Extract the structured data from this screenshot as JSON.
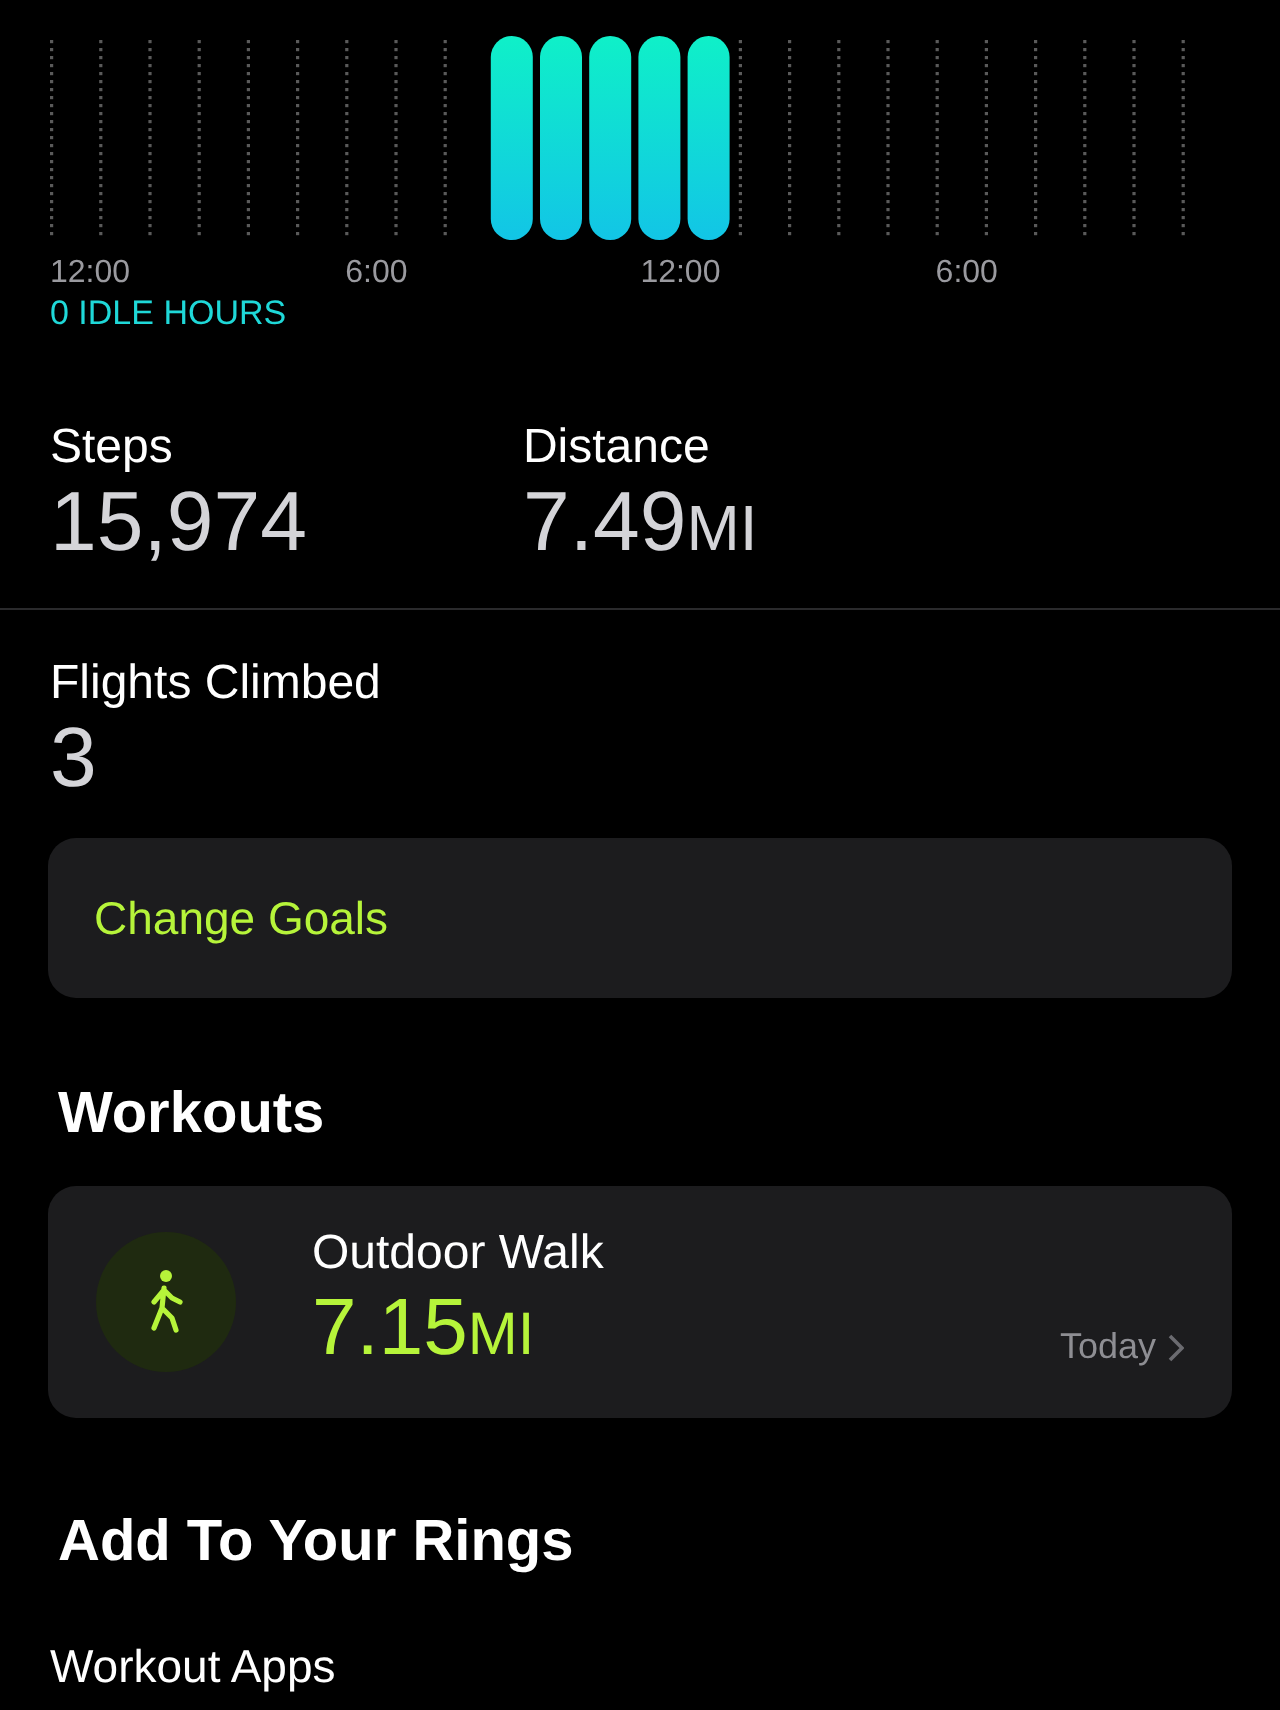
{
  "stand_chart": {
    "hours": [
      {
        "stood": false
      },
      {
        "stood": false
      },
      {
        "stood": false
      },
      {
        "stood": false
      },
      {
        "stood": false
      },
      {
        "stood": false
      },
      {
        "stood": false
      },
      {
        "stood": false
      },
      {
        "stood": false
      },
      {
        "stood": true
      },
      {
        "stood": true
      },
      {
        "stood": true
      },
      {
        "stood": true
      },
      {
        "stood": true
      },
      {
        "stood": false
      },
      {
        "stood": false
      },
      {
        "stood": false
      },
      {
        "stood": false
      },
      {
        "stood": false
      },
      {
        "stood": false
      },
      {
        "stood": false
      },
      {
        "stood": false
      },
      {
        "stood": false
      },
      {
        "stood": false
      }
    ],
    "axis_labels": [
      "12:00",
      "6:00",
      "12:00",
      "6:00"
    ],
    "idle_hours": "0 IDLE HOURS"
  },
  "metrics_row": [
    {
      "label": "Steps",
      "value": "15,974"
    },
    {
      "label": "Distance",
      "value": "7.49",
      "unit": "MI"
    }
  ],
  "flights": {
    "label": "Flights Climbed",
    "value": "3"
  },
  "change_goals": "Change Goals",
  "workouts": {
    "heading": "Workouts",
    "items": [
      {
        "name": "Outdoor Walk",
        "value": "7.15",
        "unit": "MI",
        "date": "Today"
      }
    ]
  },
  "add_to_rings": {
    "heading": "Add To Your Rings",
    "subheading": "Workout Apps"
  }
}
